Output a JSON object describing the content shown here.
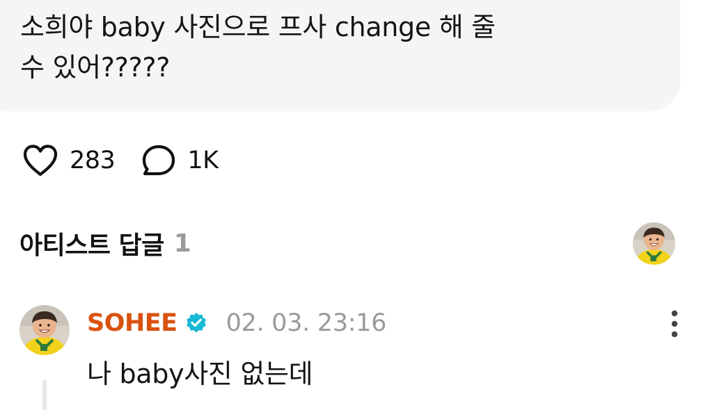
{
  "post": {
    "line1": "소희야 baby 사진으로 프사 change 해 줄",
    "line2": "수 있어?????"
  },
  "reactions": {
    "likes": "283",
    "comments": "1K"
  },
  "artist_replies": {
    "title": "아티스트 답글",
    "count": "1"
  },
  "reply": {
    "author": "SOHEE",
    "timestamp": "02. 03. 23:16",
    "text": "나 baby사진 없는데"
  },
  "icons": {
    "like": "heart-icon",
    "comment": "speech-bubble-icon",
    "verified": "verified-badge-icon",
    "more": "more-vertical-icon"
  },
  "colors": {
    "author": "#d9520f",
    "verified": "#19b9d6",
    "muted": "#9a9a9a",
    "bubble": "#f4f5f7"
  }
}
